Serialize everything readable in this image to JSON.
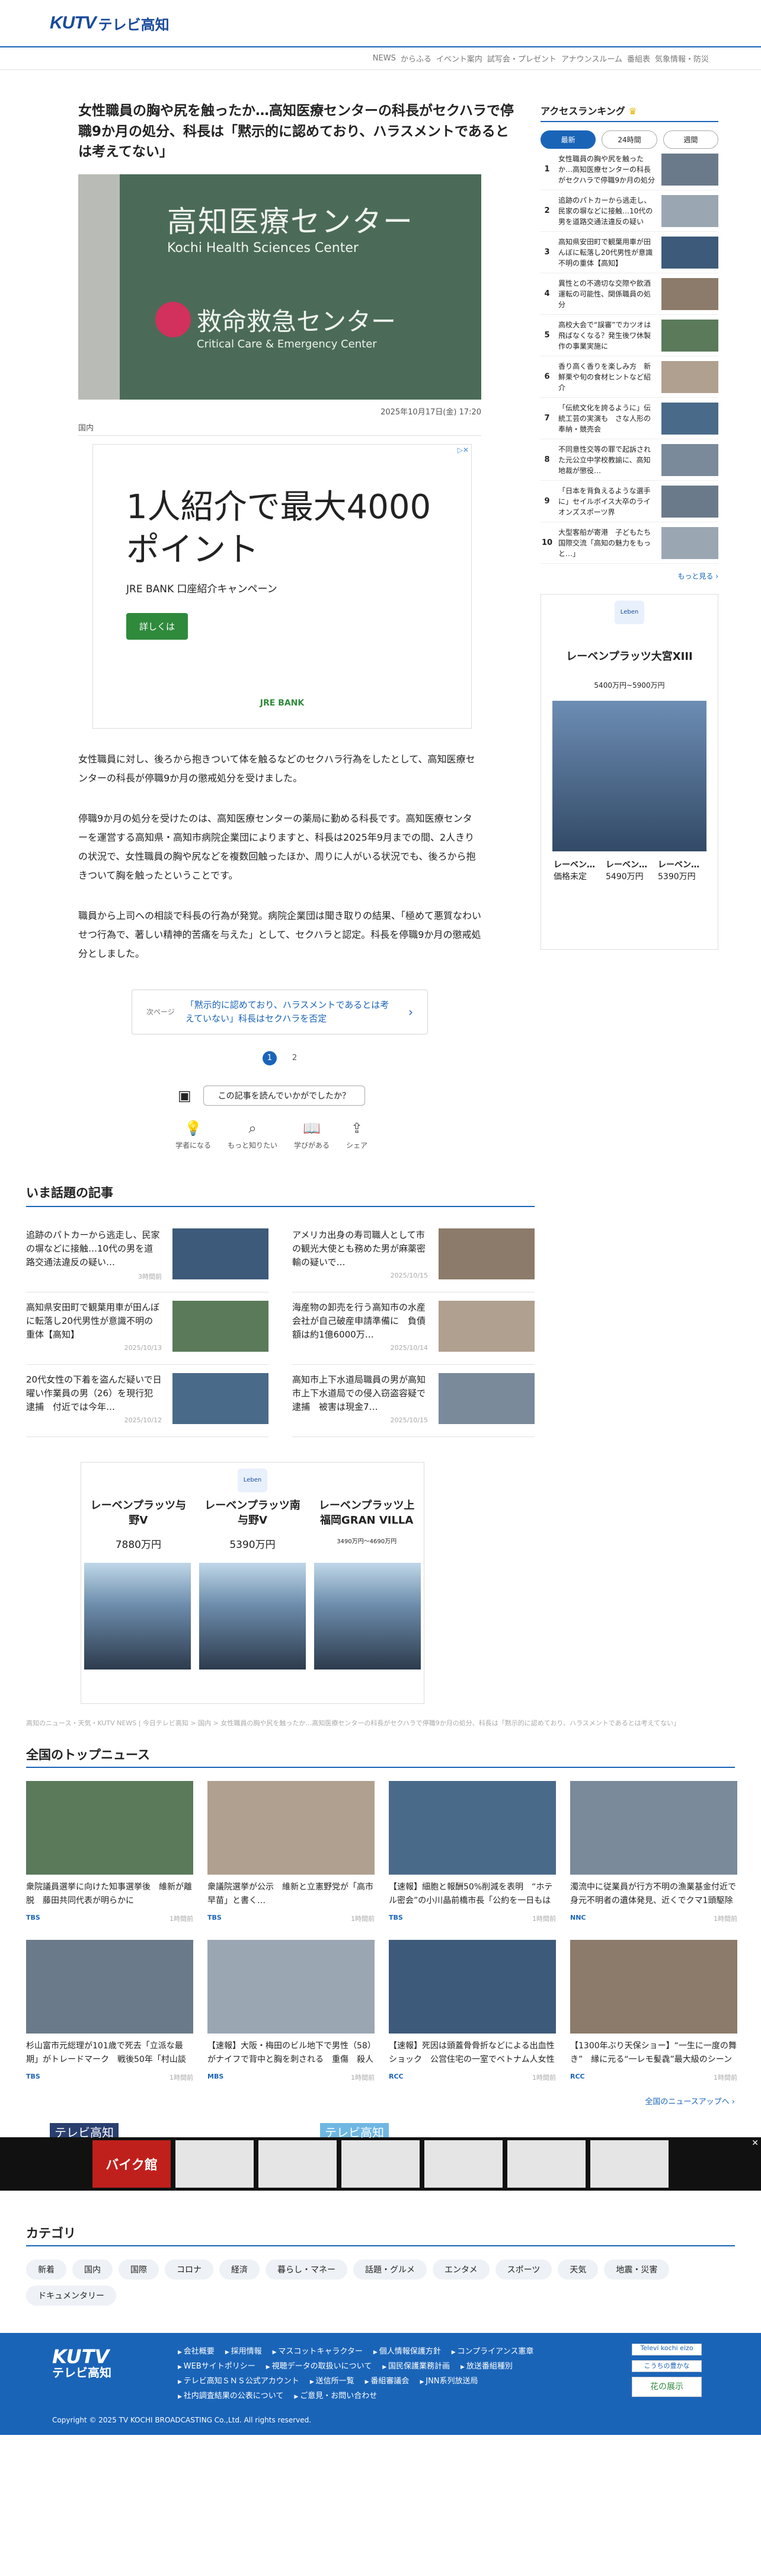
{
  "brand": {
    "mark": "KUTV",
    "sub": "テレビ高知"
  },
  "nav": [
    "NEWS",
    "からふる",
    "イベント案内",
    "試写会・プレゼント",
    "アナウンスルーム",
    "番組表",
    "気象情報・防災"
  ],
  "article": {
    "title": "女性職員の胸や尻を触ったか…高知医療センターの科長がセクハラで停職9か月の処分、科長は「黙示的に認めており、ハラスメントであるとは考えてない」",
    "hero": {
      "jp": "高知医療センター",
      "en": "Kochi Health Sciences Center",
      "er_jp": "救命救急センター",
      "er_en": "Critical Care & Emergency Center"
    },
    "date": "2025年10月17日(金) 17:20",
    "category": "国内",
    "paragraphs": [
      "女性職員に対し、後ろから抱きついて体を触るなどのセクハラ行為をしたとして、高知医療センターの科長が停職9か月の懲戒処分を受けました。",
      "停職9か月の処分を受けたのは、高知医療センターの薬局に勤める科長です。高知医療センターを運営する高知県・高知市病院企業団によりますと、科長は2025年9月までの間、2人きりの状況で、女性職員の胸や尻などを複数回触ったほか、周りに人がいる状況でも、後ろから抱きついて胸を触ったということです。",
      "職員から上司への相談で科長の行為が発覚。病院企業団は聞き取りの結果、「極めて悪質なわいせつ行為で、著しい精神的苦痛を与えた」として、セクハラと認定。科長を停職9か月の懲戒処分としました。"
    ],
    "next_page_label": "次ページ",
    "next_page_title": "「黙示的に認めており、ハラスメントであるとは考えていない」科長はセクハラを否定",
    "pages": [
      "1",
      "2"
    ],
    "feedback_q": "この記事を読んでいかがでしたか？",
    "reactions": [
      "学者になる",
      "もっと知りたい",
      "学びがある",
      "シェア"
    ]
  },
  "ad1": {
    "headline": "1人紹介で最大4000ポイント",
    "sub": "JRE BANK 口座紹介キャンペーン",
    "button": "詳しくは",
    "brand": "JRE BANK"
  },
  "trending": {
    "title": "いま話題の記事",
    "items": [
      {
        "title": "追跡のパトカーから逃走し、民家の塀などに接触…10代の男を道路交通法違反の疑い…",
        "date": "3時間前"
      },
      {
        "title": "アメリカ出身の寿司職人として市の観光大使とも務めた男が麻薬密輸の疑いで…",
        "date": "2025/10/15"
      },
      {
        "title": "高知県安田町で観葉用車が田んぼに転落し20代男性が意識不明の重体【高知】",
        "date": "2025/10/13"
      },
      {
        "title": "海産物の卸売を行う高知市の水産会社が自己破産申請準備に　負債額は約1億6000万…",
        "date": "2025/10/14"
      },
      {
        "title": "20代女性の下着を盗んだ疑いで日曜い作業員の男（26）を現行犯逮捕　付近では今年…",
        "date": "2025/10/12"
      },
      {
        "title": "高知市上下水道局職員の男が高知市上下水道局での侵入窃盗容疑で逮捕　被害は現金7…",
        "date": "2025/10/15"
      }
    ]
  },
  "ad2": {
    "items": [
      {
        "name": "レーベンプラッツ与野V",
        "price": "7880万円"
      },
      {
        "name": "レーベンプラッツ南与野V",
        "price": "5390万円"
      },
      {
        "name": "レーベンプラッツ上福岡GRAN VILLA",
        "price": "3490万円〜4690万円"
      }
    ]
  },
  "breadcrumb": "高知のニュース・天気・KUTV NEWS | 今日テレビ高知 > 国内 > 女性職員の胸や尻を触ったか…高知医療センターの科長がセクハラで停職9か月の処分、科長は「黙示的に認めており、ハラスメントであるとは考えてない」",
  "national": {
    "title": "全国のトップニュース",
    "items": [
      {
        "title": "衆院議員選挙に向けた知事選挙後　維新が離脱　藤田共同代表が明らかに",
        "src": "TBS",
        "time": "1時間前"
      },
      {
        "title": "衆議院選挙が公示　維新と立憲野党が「高市早苗」と書く…",
        "src": "TBS",
        "time": "1時間前"
      },
      {
        "title": "【速報】細胞と報酬50%削減を表明　“ホテル密会”の小川晶前橋市長「公約を一日もはやく果たしては…",
        "src": "TBS",
        "time": "1時間前"
      },
      {
        "title": "濁流中に従業員が行方不明の漁業基金付近で身元不明者の遺体発見、近くでクマ1頭駆除　異丈島前に自蔵・クマ…",
        "src": "NNC",
        "time": "1時間前"
      },
      {
        "title": "杉山富市元総理が101歳で死去「立派な最期」がトレードマーク　戦後50年「村山談話」では“日本の植民地支…",
        "src": "TBS",
        "time": "1時間前"
      },
      {
        "title": "【速報】大阪・梅田のビル地下で男性（58）がナイフで背中と胸を刺される　重傷　殺人未遂の疑いで女（4…",
        "src": "MBS",
        "time": "1時間前"
      },
      {
        "title": "【速報】死因は頭蓋骨骨折などによる出血性ショック　公営住宅の一室でベトナム人女性死亡　警察は殺人事件…",
        "src": "RCC",
        "time": "1時間前"
      },
      {
        "title": "【1300年ぶり天保ショー】“一生に一度の舞き”　縁に元る“一レモ髪毳”最大級のシーン　島の天文台職員が伝授「日…",
        "src": "RCC",
        "time": "1時間前"
      }
    ],
    "more": "全国のニュースアップへ ›"
  },
  "banner": {
    "left": "テレビ高知",
    "right": "テレビ高知",
    "shop": "バイク館"
  },
  "categories": {
    "title": "カテゴリ",
    "items": [
      "新着",
      "国内",
      "国際",
      "コロナ",
      "経済",
      "暮らし・マネー",
      "話題・グルメ",
      "エンタメ",
      "スポーツ",
      "天気",
      "地震・災害",
      "ドキュメンタリー"
    ]
  },
  "footer": {
    "links": [
      "会社概要",
      "採用情報",
      "マスコットキャラクター",
      "個人情報保護方針",
      "コンプライアンス憲章",
      "WEBサイトポリシー",
      "視聴データの取扱いについて",
      "国民保護業務計画",
      "放送番組種別",
      "テレビ高知ＳＮＳ公式アカウント",
      "送信所一覧",
      "番組審議会",
      "JNN系列放送局",
      "社内調査結果の公表について",
      "ご意見・お問い合わせ"
    ],
    "box1": "Televi kochi eizo",
    "box2": "こうちの豊かな",
    "box3": "花の展示",
    "copyright": "Copyright © 2025 TV KOCHI BROADCASTING Co.,Ltd. All rights reserved."
  },
  "sidebar": {
    "ranking_title": "アクセスランキング",
    "tabs": [
      "最新",
      "24時間",
      "週間"
    ],
    "items": [
      "女性職員の胸や尻を触ったか…高知医療センターの科長がセクハラで停職9か月の処分",
      "追跡のパトカーから逃走し、民家の塀などに接触…10代の男を道路交通法違反の疑い",
      "高知県安田町で観葉用車が田んぼに転落し20代男性が意識不明の重体【高知】",
      "異性との不適切な交際や飲酒運転の可能性、関係職員の処分",
      "高校大会で“誤審”でカツオは飛ばなくなる？発生後ワ休製作の事業実施に",
      "香り高く香りを楽しみ方　新鮮栗や旬の食材ヒントなど紹介",
      "「伝統文化を誇るように」伝統工芸の実演も　さな人形の奉納・競売会",
      "不同意性交等の罪で起訴された元公立中学校教諭に、高知地裁が懲役…",
      "「日本を背負えるような選手に」セイルボイス大卒のライオンズスポーツ界",
      "大型客船が寄港　子どもたち国際交流「高知の魅力をもっと…」"
    ],
    "more": "もっと見る ›",
    "ad": {
      "name": "レーベンプラッツ大宮XIII",
      "price": "5400万円~5900万円",
      "cards": [
        {
          "n": "レーベン…",
          "p": "価格未定"
        },
        {
          "n": "レーベン…",
          "p": "5490万円"
        },
        {
          "n": "レーベン…",
          "p": "5390万円"
        }
      ]
    }
  },
  "colors": {
    "accent": "#1a64b8",
    "ad_green": "#2f8a3c"
  }
}
